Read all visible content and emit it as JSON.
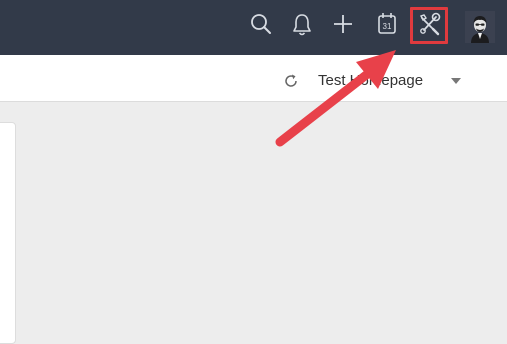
{
  "colors": {
    "topbar_bg": "#323a49",
    "icon_color": "#d8dce3",
    "highlight": "#e03a3e",
    "arrow": "#e8414a",
    "content_bg": "#ededed"
  },
  "topbar": {
    "icons": [
      "search-icon",
      "bell-icon",
      "plus-icon",
      "calendar-icon",
      "tools-icon",
      "avatar"
    ],
    "calendar_day": "31"
  },
  "subbar": {
    "homepage_label": "Test Homepage"
  }
}
